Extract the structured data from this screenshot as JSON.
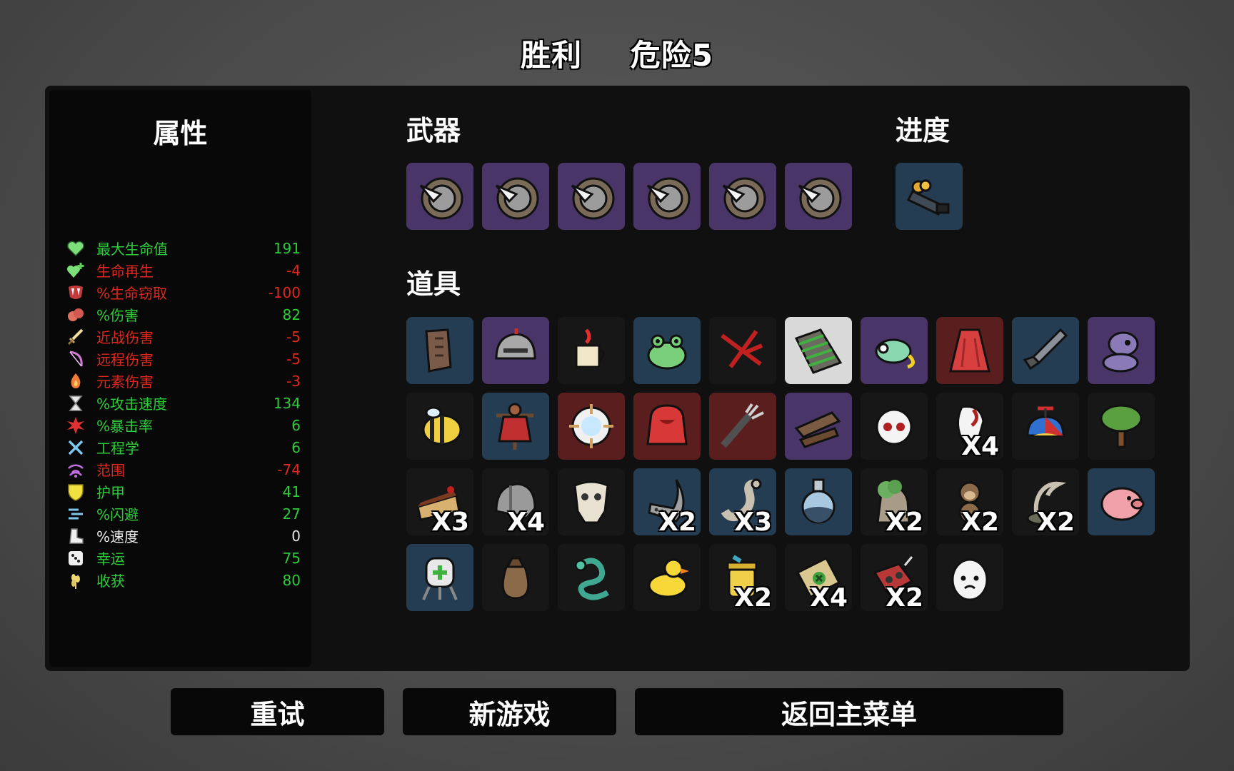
{
  "header": {
    "result": "胜利",
    "danger": "危险5"
  },
  "stats": {
    "title": "属性",
    "items": [
      {
        "icon": "heart-icon",
        "name": "最大生命值",
        "value": "191",
        "color": "green"
      },
      {
        "icon": "heart-plus-icon",
        "name": "生命再生",
        "value": "-4",
        "color": "red"
      },
      {
        "icon": "fangs-icon",
        "name": "%生命窃取",
        "value": "-100",
        "color": "red"
      },
      {
        "icon": "muscle-icon",
        "name": "%伤害",
        "value": "82",
        "color": "green"
      },
      {
        "icon": "sword-icon",
        "name": "近战伤害",
        "value": "-5",
        "color": "red"
      },
      {
        "icon": "bow-icon",
        "name": "远程伤害",
        "value": "-5",
        "color": "red"
      },
      {
        "icon": "flame-icon",
        "name": "元素伤害",
        "value": "-3",
        "color": "red"
      },
      {
        "icon": "hourglass-icon",
        "name": "%攻击速度",
        "value": "134",
        "color": "green"
      },
      {
        "icon": "crit-burst-icon",
        "name": "%暴击率",
        "value": "6",
        "color": "green"
      },
      {
        "icon": "wrench-icon",
        "name": "工程学",
        "value": "6",
        "color": "green"
      },
      {
        "icon": "range-icon",
        "name": "范围",
        "value": "-74",
        "color": "red"
      },
      {
        "icon": "shield-icon",
        "name": "护甲",
        "value": "41",
        "color": "green"
      },
      {
        "icon": "dodge-icon",
        "name": "%闪避",
        "value": "27",
        "color": "green"
      },
      {
        "icon": "boot-icon",
        "name": "%速度",
        "value": "0",
        "color": "white"
      },
      {
        "icon": "dice-icon",
        "name": "幸运",
        "value": "75",
        "color": "green"
      },
      {
        "icon": "wheat-icon",
        "name": "收获",
        "value": "80",
        "color": "green"
      }
    ]
  },
  "weapons": {
    "title": "武器",
    "items": [
      {
        "icon": "spiked-shield-icon",
        "tier": "purple"
      },
      {
        "icon": "spiked-shield-icon",
        "tier": "purple"
      },
      {
        "icon": "spiked-shield-icon",
        "tier": "purple"
      },
      {
        "icon": "spiked-shield-icon",
        "tier": "purple"
      },
      {
        "icon": "spiked-shield-icon",
        "tier": "purple"
      },
      {
        "icon": "spiked-shield-icon",
        "tier": "purple"
      }
    ]
  },
  "progress": {
    "title": "进度",
    "items": [
      {
        "icon": "gold-cart-icon",
        "tier": "blue"
      }
    ]
  },
  "items": {
    "title": "道具",
    "list": [
      {
        "icon": "leather-vest-icon",
        "tier": "blue",
        "count": ""
      },
      {
        "icon": "knight-helmet-icon",
        "tier": "purple",
        "count": ""
      },
      {
        "icon": "coffee-cup-icon",
        "tier": "dark",
        "count": ""
      },
      {
        "icon": "frog-icon",
        "tier": "blue",
        "count": ""
      },
      {
        "icon": "red-scar-icon",
        "tier": "dark",
        "count": ""
      },
      {
        "icon": "mossy-bark-icon",
        "tier": "white",
        "count": ""
      },
      {
        "icon": "chameleon-icon",
        "tier": "purple",
        "count": ""
      },
      {
        "icon": "red-cape-icon",
        "tier": "red",
        "count": ""
      },
      {
        "icon": "missile-icon",
        "tier": "blue",
        "count": ""
      },
      {
        "icon": "alien-plush-icon",
        "tier": "purple",
        "count": ""
      },
      {
        "icon": "bee-icon",
        "tier": "dark",
        "count": ""
      },
      {
        "icon": "scarecrow-icon",
        "tier": "blue",
        "count": ""
      },
      {
        "icon": "snowball-icon",
        "tier": "red",
        "count": ""
      },
      {
        "icon": "red-hoodie-icon",
        "tier": "red",
        "count": ""
      },
      {
        "icon": "claw-arm-icon",
        "tier": "red",
        "count": ""
      },
      {
        "icon": "wood-planks-icon",
        "tier": "purple",
        "count": ""
      },
      {
        "icon": "ghost-mask-icon",
        "tier": "dark",
        "count": ""
      },
      {
        "icon": "tooth-icon",
        "tier": "dark",
        "count": "X4"
      },
      {
        "icon": "propeller-hat-icon",
        "tier": "dark",
        "count": ""
      },
      {
        "icon": "tree-icon",
        "tier": "dark",
        "count": ""
      },
      {
        "icon": "cake-slice-icon",
        "tier": "dark",
        "count": "X3"
      },
      {
        "icon": "grey-helmet-icon",
        "tier": "dark",
        "count": "X4"
      },
      {
        "icon": "bone-skull-icon",
        "tier": "dark",
        "count": ""
      },
      {
        "icon": "blade-guard-icon",
        "tier": "blue",
        "count": "X2"
      },
      {
        "icon": "worm-icon",
        "tier": "blue",
        "count": "X3"
      },
      {
        "icon": "potion-flask-icon",
        "tier": "blue",
        "count": ""
      },
      {
        "icon": "moss-sack-icon",
        "tier": "dark",
        "count": "X2"
      },
      {
        "icon": "monkey-icon",
        "tier": "dark",
        "count": "X2"
      },
      {
        "icon": "sickle-plant-icon",
        "tier": "dark",
        "count": "X2"
      },
      {
        "icon": "piggy-bank-icon",
        "tier": "blue",
        "count": ""
      },
      {
        "icon": "medic-pack-icon",
        "tier": "blue",
        "count": ""
      },
      {
        "icon": "loot-bag-icon",
        "tier": "dark",
        "count": ""
      },
      {
        "icon": "green-snake-icon",
        "tier": "dark",
        "count": ""
      },
      {
        "icon": "rubber-duck-icon",
        "tier": "dark",
        "count": ""
      },
      {
        "icon": "honey-jar-icon",
        "tier": "dark",
        "count": "X2"
      },
      {
        "icon": "treasure-map-icon",
        "tier": "dark",
        "count": "X4"
      },
      {
        "icon": "red-gear-icon",
        "tier": "dark",
        "count": "X2"
      },
      {
        "icon": "egg-face-icon",
        "tier": "dark",
        "count": ""
      }
    ]
  },
  "buttons": {
    "retry": "重试",
    "new_game": "新游戏",
    "main_menu": "返回主菜单"
  }
}
